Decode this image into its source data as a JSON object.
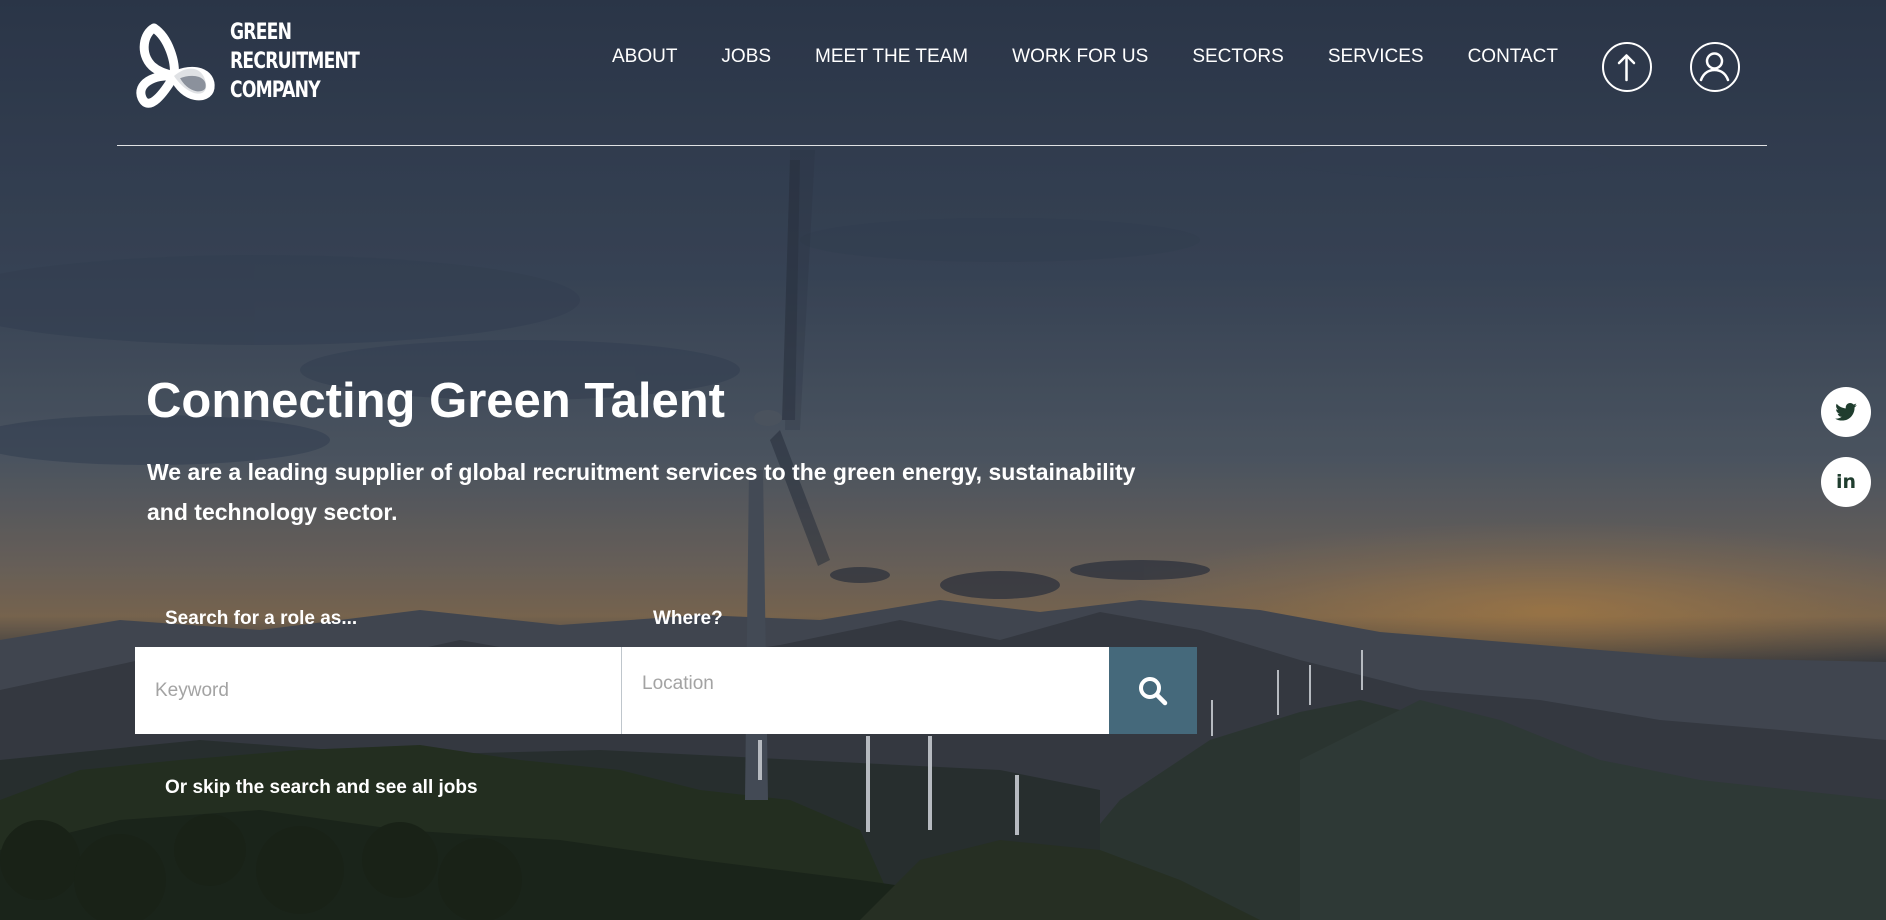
{
  "brand": {
    "logo_lines": [
      "GREEN",
      "RECRUITMENT",
      "COMPANY"
    ]
  },
  "nav": {
    "items": [
      "ABOUT",
      "JOBS",
      "MEET THE TEAM",
      "WORK FOR US",
      "SECTORS",
      "SERVICES",
      "CONTACT"
    ]
  },
  "header_icons": {
    "upload": "upload-arrow-icon",
    "account": "user-account-icon"
  },
  "hero": {
    "title": "Connecting Green Talent",
    "subtitle": "We are a leading supplier of global recruitment services to the green energy, sustainability and technology sector."
  },
  "search": {
    "keyword_label": "Search for a role as...",
    "keyword_placeholder": "Keyword",
    "location_label": "Where?",
    "location_placeholder": "Location",
    "button_icon": "search-icon",
    "button_color": "#45697b",
    "skip_link": "Or skip the search and see all jobs"
  },
  "social": {
    "twitter_icon": "twitter-icon",
    "linkedin_text": "in",
    "icon_color": "#1f3d2e"
  }
}
